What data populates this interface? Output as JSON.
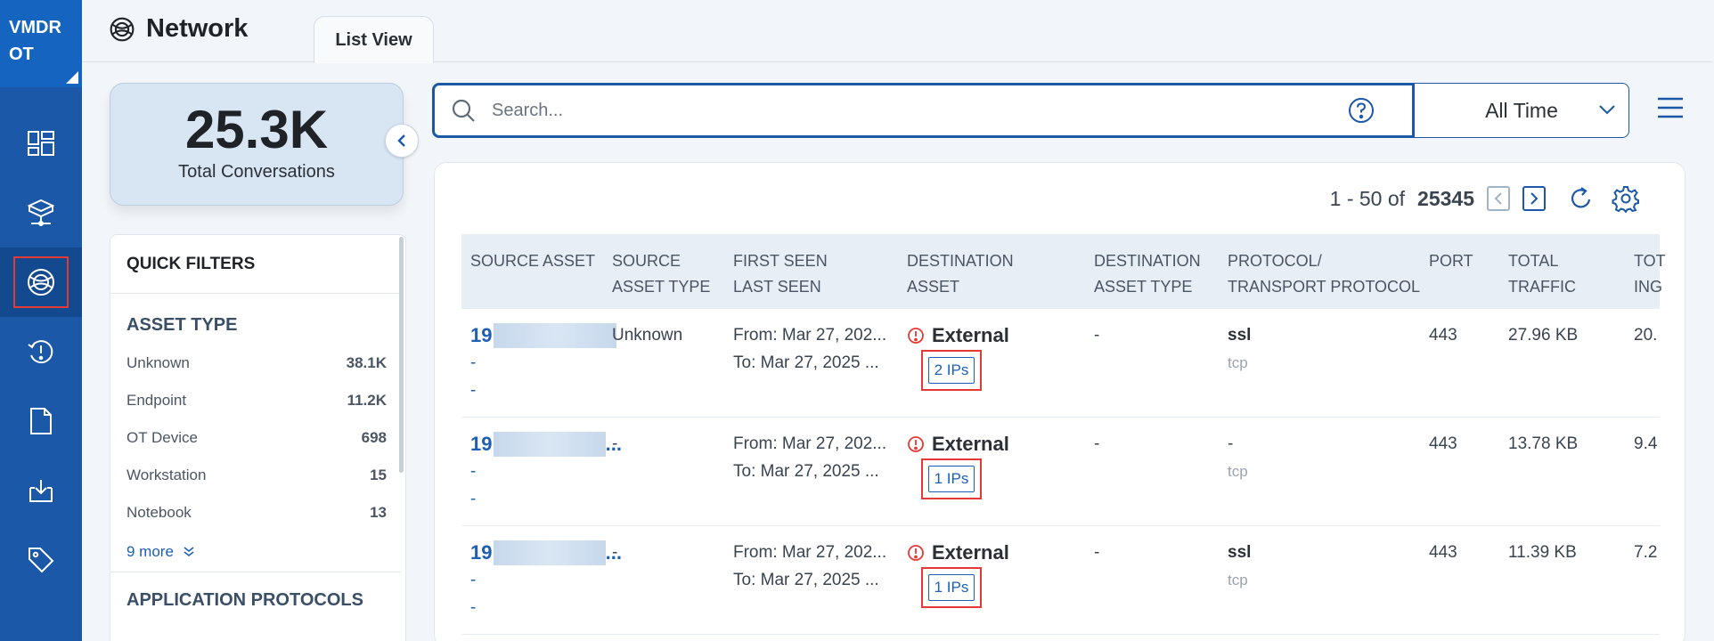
{
  "brand": {
    "line1": "VMDR",
    "line2": "OT"
  },
  "sidebar": {
    "items": [
      {
        "name": "dashboard-icon"
      },
      {
        "name": "asset-inventory-icon"
      },
      {
        "name": "network-icon",
        "active": true
      },
      {
        "name": "alert-history-icon"
      },
      {
        "name": "report-icon"
      },
      {
        "name": "inbox-download-icon"
      },
      {
        "name": "tag-icon"
      }
    ]
  },
  "header": {
    "title": "Network",
    "tab": "List View"
  },
  "summary": {
    "value": "25.3K",
    "label": "Total Conversations"
  },
  "filters": {
    "title": "QUICK FILTERS",
    "asset_type": {
      "title": "ASSET TYPE",
      "items": [
        {
          "label": "Unknown",
          "count": "38.1K"
        },
        {
          "label": "Endpoint",
          "count": "11.2K"
        },
        {
          "label": "OT Device",
          "count": "698"
        },
        {
          "label": "Workstation",
          "count": "15"
        },
        {
          "label": "Notebook",
          "count": "13"
        }
      ],
      "more": "9 more"
    },
    "app_protocols_title": "APPLICATION PROTOCOLS"
  },
  "search": {
    "placeholder": "Search..."
  },
  "time_filter": {
    "selected": "All Time"
  },
  "pager": {
    "range": "1 - 50 of",
    "total": "25345"
  },
  "table": {
    "columns": [
      {
        "l1": "",
        "l2": "SOURCE ASSET"
      },
      {
        "l1": "SOURCE",
        "l2": "ASSET TYPE"
      },
      {
        "l1": "FIRST SEEN",
        "l2": "LAST SEEN"
      },
      {
        "l1": "DESTINATION",
        "l2": "ASSET"
      },
      {
        "l1": "DESTINATION",
        "l2": "ASSET TYPE"
      },
      {
        "l1": "PROTOCOL/",
        "l2": "TRANSPORT PROTOCOL"
      },
      {
        "l1": "",
        "l2": "PORT"
      },
      {
        "l1": "TOTAL",
        "l2": "TRAFFIC"
      },
      {
        "l1": "TOT",
        "l2": "ING"
      }
    ],
    "rows": [
      {
        "src_prefix": "19",
        "src_suffix": "",
        "src_line2": "-",
        "src_line3": "-",
        "src_type": "Unknown",
        "from": "From: Mar 27, 202...",
        "to": "To: Mar 27, 2025 ...",
        "dest": "External",
        "ips": "2 IPs",
        "dest_type": "-",
        "protocol": "ssl",
        "transport": "tcp",
        "port": "443",
        "traffic": "27.96 KB",
        "ing": "20."
      },
      {
        "src_prefix": "19",
        "src_suffix": "...",
        "src_line2": "-",
        "src_line3": "-",
        "src_type": "-",
        "from": "From: Mar 27, 202...",
        "to": "To: Mar 27, 2025 ...",
        "dest": "External",
        "ips": "1 IPs",
        "dest_type": "-",
        "protocol": "-",
        "transport": "tcp",
        "port": "443",
        "traffic": "13.78 KB",
        "ing": "9.4"
      },
      {
        "src_prefix": "19",
        "src_suffix": "...",
        "src_line2": "-",
        "src_line3": "-",
        "src_type": "-",
        "from": "From: Mar 27, 202...",
        "to": "To: Mar 27, 2025 ...",
        "dest": "External",
        "ips": "1 IPs",
        "dest_type": "-",
        "protocol": "ssl",
        "transport": "tcp",
        "port": "443",
        "traffic": "11.39 KB",
        "ing": "7.2"
      }
    ]
  }
}
